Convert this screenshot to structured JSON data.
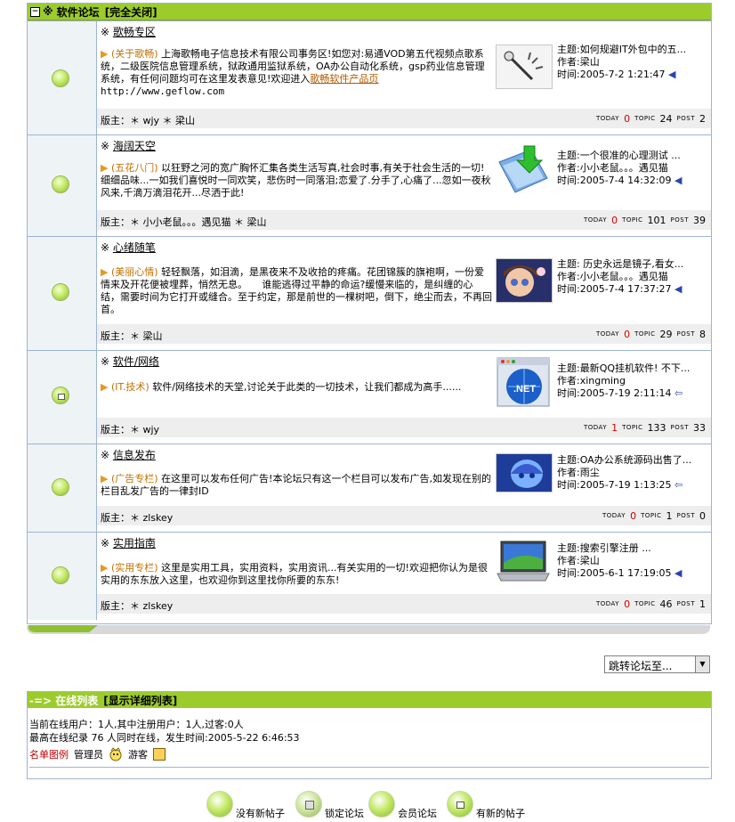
{
  "forum": {
    "prefix": "※",
    "name": "软件论坛",
    "status": "[完全关闭]"
  },
  "boards": [
    {
      "name": "歌畅专区",
      "tag": "(关于歌畅)",
      "desc": "上海歌畅电子信息技术有限公司事务区!如您对:易通VOD第五代视频点歌系统，二级医院信息管理系统，狱政通用监狱系统，OA办公自动化系统，gsp药业信息管理系统，有任何问题均可在这里发表意见!欢迎进入",
      "link_text": "歌畅软件产品页",
      "link_url": "http://www.geflow.com",
      "moderators": "版主：＊ wjy ＊ 梁山",
      "last": {
        "subject": "主题:如何规避IT外包中的五...",
        "author": "作者:梁山",
        "time": "时间:2005-7-2 1:21:47"
      },
      "stats": {
        "today": "0",
        "topic": "24",
        "post": "2"
      }
    },
    {
      "name": "海阔天空",
      "tag": "(五花八门)",
      "desc": "以狂野之河的宽广胸怀汇集各类生活写真,社会时事,有关于社会生活的一切!细细品味...一如我们喜悦时一同欢笑，悲伤时一同落泪;恋爱了.分手了,心痛了...忽如一夜秋风来,千滴万滴泪花开...尽洒于此!",
      "moderators": "版主：＊ 小小老鼠。。。遇见猫 ＊ 梁山",
      "last": {
        "subject": "主题:一个很准的心理测试 ...",
        "author": "作者:小小老鼠。。。遇见猫",
        "time": "时间:2005-7-4 14:32:09"
      },
      "stats": {
        "today": "0",
        "topic": "101",
        "post": "39"
      }
    },
    {
      "name": "心绪随笔",
      "tag": "(美丽心情)",
      "desc": "轻轻飘落，如泪滴，是黑夜来不及收拾的疼痛。花团锦簇的旗袍啊，一份爱情来及开花便被埋葬，悄然无息。　　谁能逃得过平静的命运?缓慢来临的，是纠缠的心结，需要时间为它打开或缝合。至于约定，那是前世的一棵树吧，倒下，绝尘而去，不再回首。",
      "moderators": "版主：＊ 梁山",
      "last": {
        "subject": "主题: 历史永远是镜子,看女...",
        "author": "作者:小小老鼠。。。遇见猫",
        "time": "时间:2005-7-4 17:37:27"
      },
      "stats": {
        "today": "0",
        "topic": "29",
        "post": "8"
      }
    },
    {
      "name": "软件/网络",
      "tag": "(IT.技术)",
      "desc": "软件/网络技术的天堂,讨论关于此类的一切技术，让我们都成为高手......",
      "moderators": "版主：＊ wjy",
      "last": {
        "subject": "主题:最新QQ挂机软件! 不下...",
        "author": "作者:xingming",
        "time": "时间:2005-7-19 2:11:14"
      },
      "stats": {
        "today": "1",
        "topic": "133",
        "post": "33"
      }
    },
    {
      "name": "信息发布",
      "tag": "(广告专栏)",
      "desc": "在这里可以发布任何广告!本论坛只有这一个栏目可以发布广告,如发现在别的栏目乱发广告的一律封ID",
      "moderators": "版主：＊ zlskey",
      "last": {
        "subject": "主题:OA办公系统源码出售了...",
        "author": "作者:雨尘",
        "time": "时间:2005-7-19 1:13:25"
      },
      "stats": {
        "today": "0",
        "topic": "1",
        "post": "0"
      }
    },
    {
      "name": "实用指南",
      "tag": "(实用专栏)",
      "desc": "这里是实用工具，实用资料，实用资讯...有关实用的一切!欢迎把你认为是很实用的东东放入这里，也欢迎你到这里找你所要的东东!",
      "moderators": "版主：＊ zlskey",
      "last": {
        "subject": "主题:搜索引擎注册 ...",
        "author": "作者:梁山",
        "time": "时间:2005-6-1 17:19:05"
      },
      "stats": {
        "today": "0",
        "topic": "46",
        "post": "1"
      }
    }
  ],
  "stat_labels": {
    "today": "TODAY",
    "topic": "TOPIC",
    "post": "POST"
  },
  "jump": {
    "label": "跳转论坛至..."
  },
  "online": {
    "title": "-=> 在线列表",
    "detail_link": "[显示详细列表]",
    "line1": "当前在线用户：1人,其中注册用户：1人,过客:0人",
    "line2": "最高在线纪录 76 人同时在线，发生时间:2005-5-22 6:46:53",
    "legend_label": "名单图例",
    "admin": "管理员",
    "guest": "游客"
  },
  "legend": {
    "no_new": "没有新帖子",
    "locked": "锁定论坛",
    "member": "会员论坛",
    "has_new": "有新的帖子"
  }
}
